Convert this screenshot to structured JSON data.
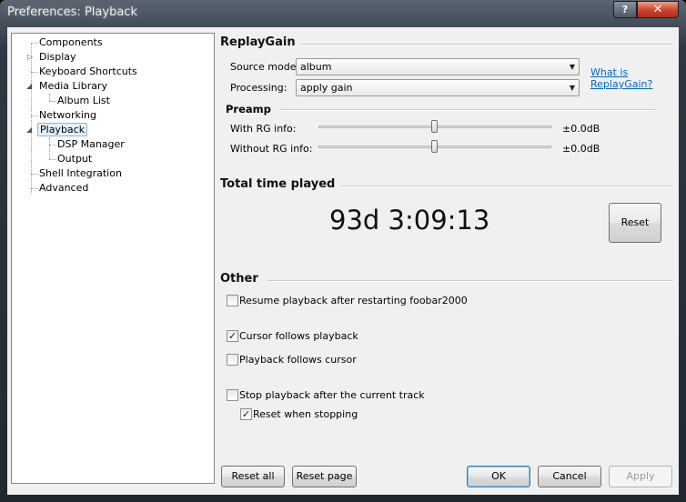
{
  "window": {
    "title": "Preferences: Playback",
    "help_label": "?",
    "close_label": "✕"
  },
  "tree": {
    "items": [
      {
        "label": "Components"
      },
      {
        "label": "Display"
      },
      {
        "label": "Keyboard Shortcuts"
      },
      {
        "label": "Media Library"
      },
      {
        "label": "Album List"
      },
      {
        "label": "Networking"
      },
      {
        "label": "Playback"
      },
      {
        "label": "DSP Manager"
      },
      {
        "label": "Output"
      },
      {
        "label": "Shell Integration"
      },
      {
        "label": "Advanced"
      }
    ],
    "expand_collapsed_glyph": "▷",
    "expand_open_glyph": "◢"
  },
  "replaygain": {
    "title": "ReplayGain",
    "source_mode_label": "Source mode:",
    "source_mode_value": "album",
    "processing_label": "Processing:",
    "processing_value": "apply gain",
    "what_is_link": "What is ReplayGain?",
    "what_is_line1": "What is",
    "what_is_line2": "ReplayGain?",
    "dropdown_glyph": "▼"
  },
  "preamp": {
    "title": "Preamp",
    "with_rg_label": "With RG info:",
    "with_rg_value": "±0.0dB",
    "with_rg_level": 0.5,
    "without_rg_label": "Without RG info:",
    "without_rg_value": "±0.0dB",
    "without_rg_level": 0.5
  },
  "total_time": {
    "title": "Total time played",
    "value": "93d 3:09:13",
    "reset_label": "Reset"
  },
  "other": {
    "title": "Other",
    "options": [
      {
        "label": "Resume playback after restarting foobar2000",
        "checked": false
      },
      {
        "label": "Cursor follows playback",
        "checked": true
      },
      {
        "label": "Playback follows cursor",
        "checked": false
      },
      {
        "label": "Stop playback after the current track",
        "checked": false
      },
      {
        "label": "Reset when stopping",
        "checked": true
      }
    ],
    "check_glyph": "✓"
  },
  "footer": {
    "reset_all_label": "Reset all",
    "reset_page_label": "Reset page",
    "ok_label": "OK",
    "cancel_label": "Cancel",
    "apply_label": "Apply"
  }
}
